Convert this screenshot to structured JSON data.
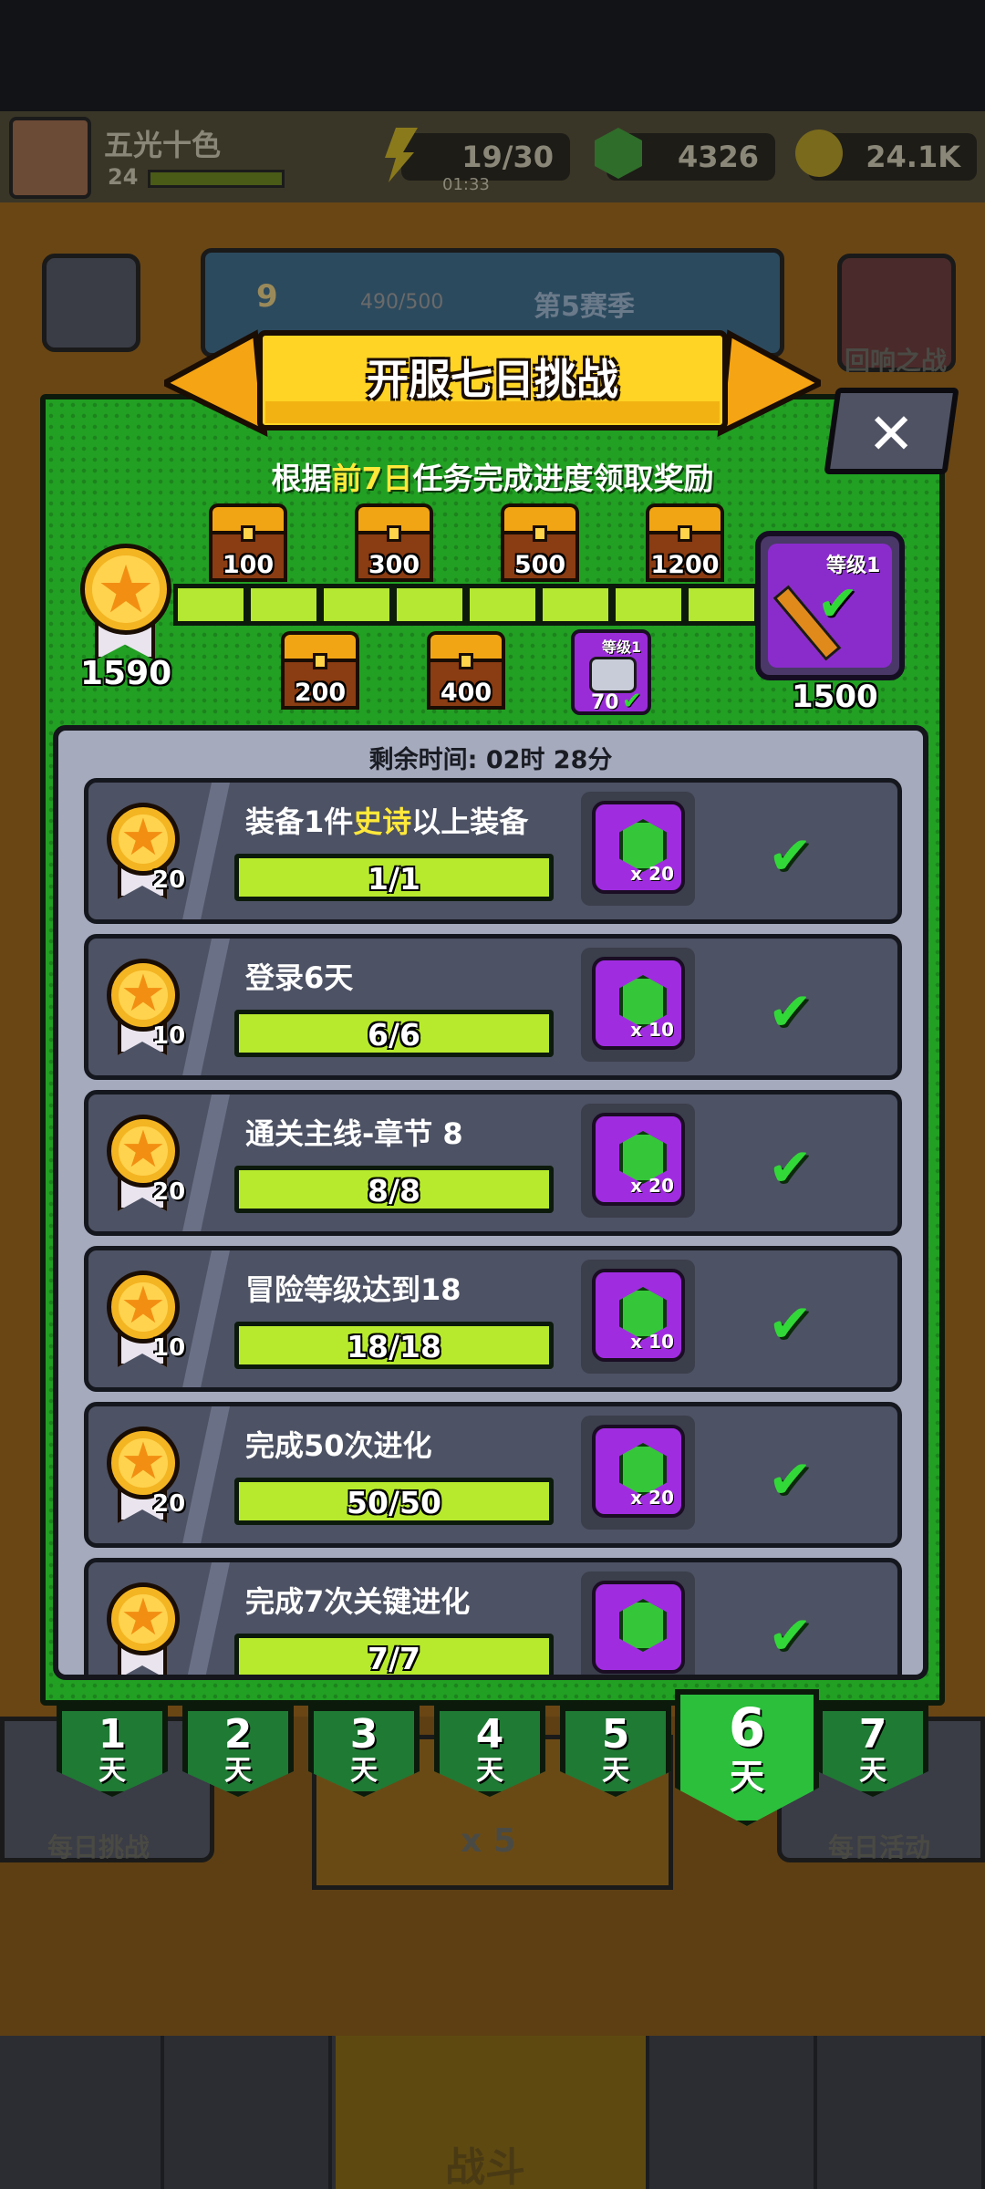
{
  "hud": {
    "player_name": "五光十色",
    "level": "24",
    "energy": "19/30",
    "energy_timer": "01:33",
    "gems": "4326",
    "gold": "24.1K"
  },
  "background": {
    "season_progress": "490/500",
    "season_level": "9",
    "season_label": "第5赛季",
    "echo_battle": "回响之战",
    "daily_challenge": "每日挑战",
    "daily_activity": "每日活动",
    "energy_cost": "x 5",
    "battle": "战斗"
  },
  "modal": {
    "title": "开服七日挑战",
    "subtitle_pre": "根据",
    "subtitle_hl": "前7日",
    "subtitle_post": "任务完成进度领取奖励",
    "points": "1590",
    "milestones_top": [
      "100",
      "300",
      "500",
      "1200"
    ],
    "milestones_bottom": [
      "200",
      "400"
    ],
    "milestone_item_label": "等级1",
    "milestone_item_value": "70",
    "final_reward_label": "等级1",
    "final_reward_value": "1500",
    "progress_fraction": 0.83,
    "timer": "剩余时间: 02时 28分"
  },
  "tasks": [
    {
      "name_pre": "装备1件",
      "name_hl": "史诗",
      "name_post": "以上装备",
      "points": "20",
      "progress": "1/1",
      "reward_qty": "x 20"
    },
    {
      "name_pre": "登录6天",
      "name_hl": "",
      "name_post": "",
      "points": "10",
      "progress": "6/6",
      "reward_qty": "x 10"
    },
    {
      "name_pre": "通关主线-章节 8",
      "name_hl": "",
      "name_post": "",
      "points": "20",
      "progress": "8/8",
      "reward_qty": "x 20"
    },
    {
      "name_pre": "冒险等级达到18",
      "name_hl": "",
      "name_post": "",
      "points": "10",
      "progress": "18/18",
      "reward_qty": "x 10"
    },
    {
      "name_pre": "完成50次进化",
      "name_hl": "",
      "name_post": "",
      "points": "20",
      "progress": "50/50",
      "reward_qty": "x 20"
    },
    {
      "name_pre": "完成7次关键进化",
      "name_hl": "",
      "name_post": "",
      "points": "",
      "progress": "7/7",
      "reward_qty": ""
    }
  ],
  "days": [
    {
      "num": "1",
      "unit": "天"
    },
    {
      "num": "2",
      "unit": "天"
    },
    {
      "num": "3",
      "unit": "天"
    },
    {
      "num": "4",
      "unit": "天"
    },
    {
      "num": "5",
      "unit": "天"
    },
    {
      "num": "6",
      "unit": "天"
    },
    {
      "num": "7",
      "unit": "天"
    }
  ],
  "close_glyph": "✕",
  "check_glyph": "✔",
  "colors": {
    "accent_green": "#22a023",
    "progress_lime": "#b4e832",
    "highlight_yellow": "#ffe83a",
    "gem_purple": "#a02ce0"
  }
}
